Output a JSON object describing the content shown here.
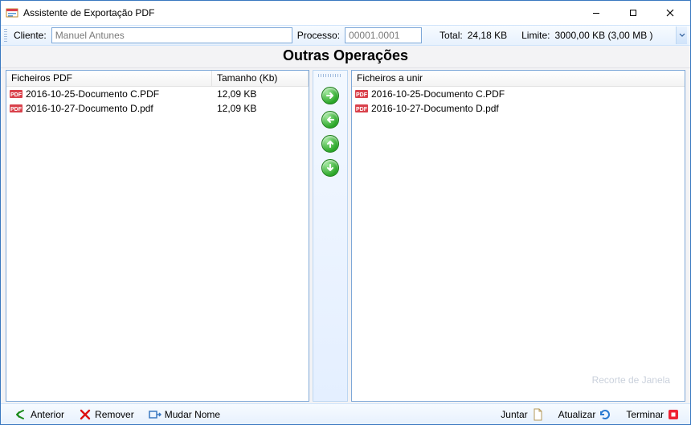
{
  "window": {
    "title": "Assistente de Exportação PDF"
  },
  "toolbar": {
    "cliente_label": "Cliente:",
    "cliente_value": "Manuel Antunes",
    "processo_label": "Processo:",
    "processo_value": "00001.0001",
    "total_label": "Total:",
    "total_value": "24,18 KB",
    "limite_label": "Limite:",
    "limite_value": "3000,00 KB (3,00 MB )"
  },
  "section_title": "Outras Operações",
  "left_pane": {
    "header_name": "Ficheiros PDF",
    "header_size": "Tamanho (Kb)",
    "rows": [
      {
        "name": "2016-10-25-Documento C.PDF",
        "size": "12,09 KB"
      },
      {
        "name": "2016-10-27-Documento D.pdf",
        "size": "12,09 KB"
      }
    ]
  },
  "right_pane": {
    "header_name": "Ficheiros a unir",
    "rows": [
      {
        "name": "2016-10-25-Documento C.PDF"
      },
      {
        "name": "2016-10-27-Documento D.pdf"
      }
    ]
  },
  "center_buttons": {
    "add": "add-right",
    "remove": "remove-left",
    "up": "move-up",
    "down": "move-down"
  },
  "bottombar": {
    "anterior": "Anterior",
    "remover": "Remover",
    "mudar_nome": "Mudar Nome",
    "juntar": "Juntar",
    "atualizar": "Atualizar",
    "terminar": "Terminar"
  },
  "watermark": "Recorte de Janela"
}
